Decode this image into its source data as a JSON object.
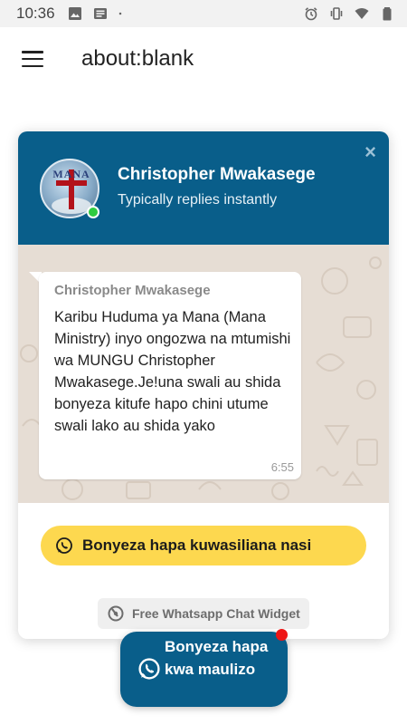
{
  "status_bar": {
    "time": "10:36",
    "left_icons": [
      "image-icon",
      "news-icon",
      "dot-icon"
    ],
    "right_icons": [
      "alarm-icon",
      "vibrate-icon",
      "wifi-icon",
      "battery-icon"
    ]
  },
  "app_bar": {
    "menu_icon": "hamburger-menu-icon",
    "url": "about:blank"
  },
  "widget": {
    "header": {
      "name": "Christopher Mwakasege",
      "subtitle": "Typically replies instantly",
      "close_symbol": "×",
      "avatar_logo_text": "MANA",
      "online": true
    },
    "message": {
      "author": "Christopher Mwakasege",
      "text": "Karibu Huduma ya Mana (Mana Ministry) inyo ongozwa na mtumishi wa MUNGU Christopher Mwakasege.Je!una swali au shida bonyeza kitufe hapo chini utume swali lako au shida yako",
      "time": "6:55"
    },
    "cta": {
      "label": "Bonyeza hapa kuwasiliana nasi",
      "icon": "whatsapp-icon",
      "color": "#fdd84f"
    },
    "footer": {
      "label": "Free Whatsapp Chat Widget",
      "icon": "widget-logo-icon"
    },
    "colors": {
      "header": "#095e8a",
      "chat_bg": "#e6ddd4",
      "online": "#2ecc40"
    }
  },
  "fab": {
    "label": "Bonyeza hapa kwa maulizo",
    "icon": "whatsapp-icon",
    "badge_color": "#ee1515"
  }
}
